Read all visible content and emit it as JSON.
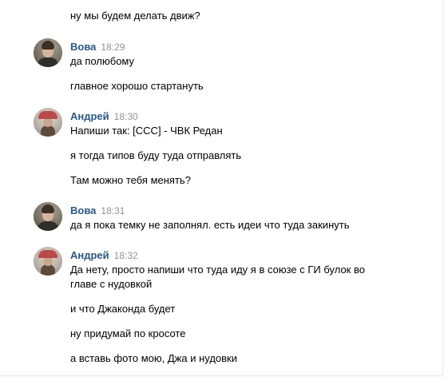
{
  "messages": [
    {
      "type": "text",
      "text": "ну мы будем делать движ?"
    },
    {
      "type": "header",
      "author": "Вова",
      "time": "18:29",
      "avatar": "avatar-vova"
    },
    {
      "type": "text",
      "text": "да полюбому"
    },
    {
      "type": "text",
      "text": "главное хорошо стартануть"
    },
    {
      "type": "header",
      "author": "Андрей",
      "time": "18:30",
      "avatar": "avatar-andrey"
    },
    {
      "type": "text",
      "text": "Напиши так: [ССС] - ЧВК Редан"
    },
    {
      "type": "text",
      "text": "я тогда типов буду туда отправлять"
    },
    {
      "type": "text",
      "text": "Там можно тебя менять?"
    },
    {
      "type": "header",
      "author": "Вова",
      "time": "18:31",
      "avatar": "avatar-vova"
    },
    {
      "type": "text",
      "text": "да я пока темку не заполнял. есть идеи что туда закинуть"
    },
    {
      "type": "header",
      "author": "Андрей",
      "time": "18:32",
      "avatar": "avatar-andrey"
    },
    {
      "type": "text",
      "text": "Да нету, просто напиши что туда иду я в союзе с ГИ булок во"
    },
    {
      "type": "text",
      "text": "главе с нудовкой"
    },
    {
      "type": "text",
      "text": "и что Джаконда будет"
    },
    {
      "type": "text",
      "text": "ну придумай по кросоте"
    },
    {
      "type": "text",
      "text": "а вставь фото мою, Джа и нудовки"
    }
  ],
  "colors": {
    "author": "#2a5885",
    "time": "#939393",
    "text": "#000000",
    "divider": "#e7e8ec"
  }
}
